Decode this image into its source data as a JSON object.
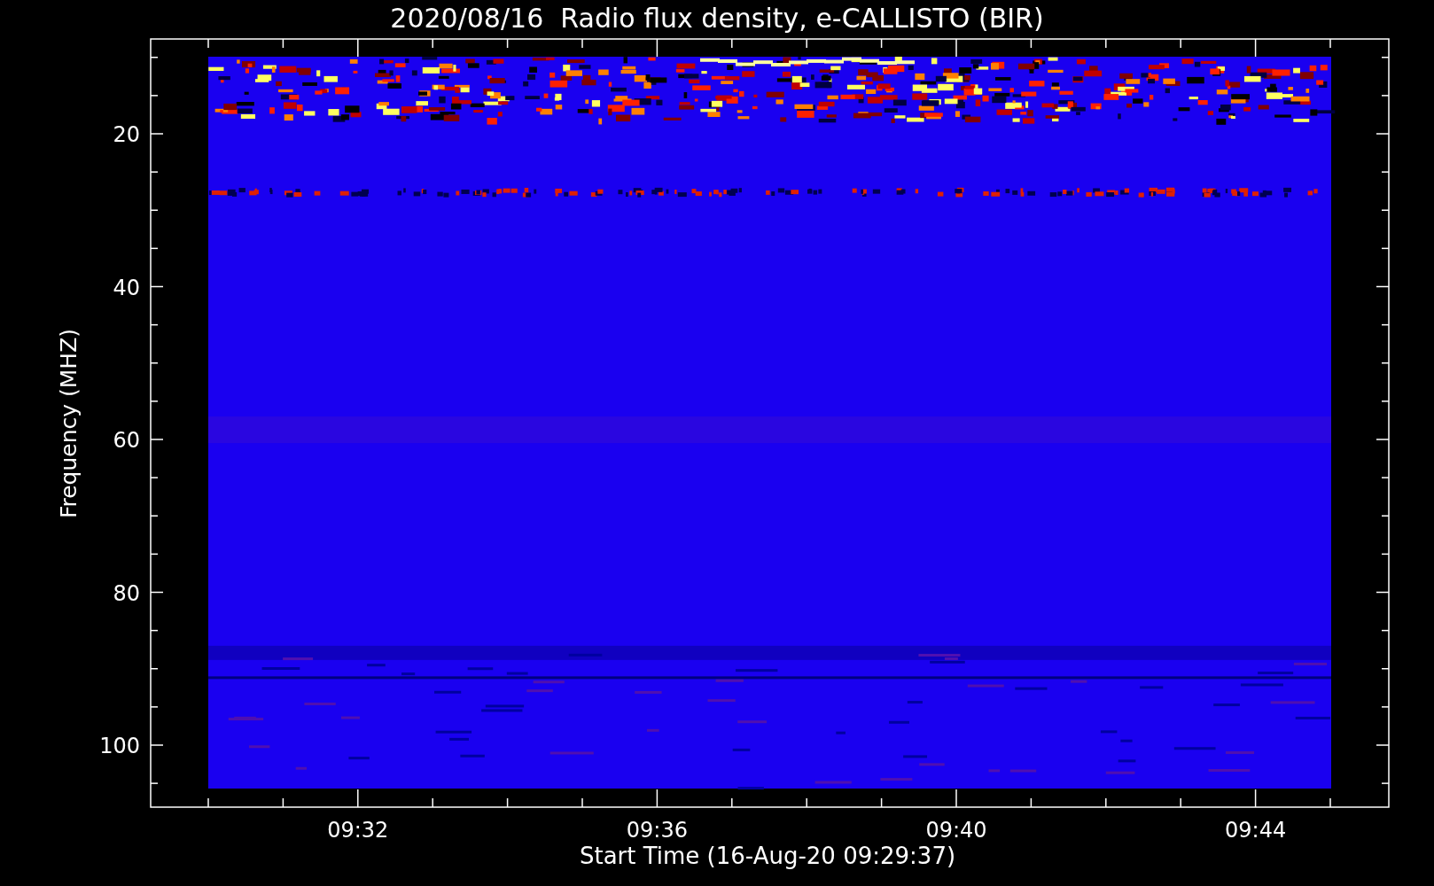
{
  "plot": {
    "title": "2020/08/16  Radio flux density, e-CALLISTO (BIR)",
    "ylabel": "Frequency (MHZ)",
    "xlabel": "Start Time (16-Aug-20 09:29:37)",
    "ytick_labels": [
      "20",
      "40",
      "60",
      "80",
      "100"
    ],
    "xtick_labels": [
      "09:32",
      "09:36",
      "09:40",
      "09:44"
    ]
  }
}
